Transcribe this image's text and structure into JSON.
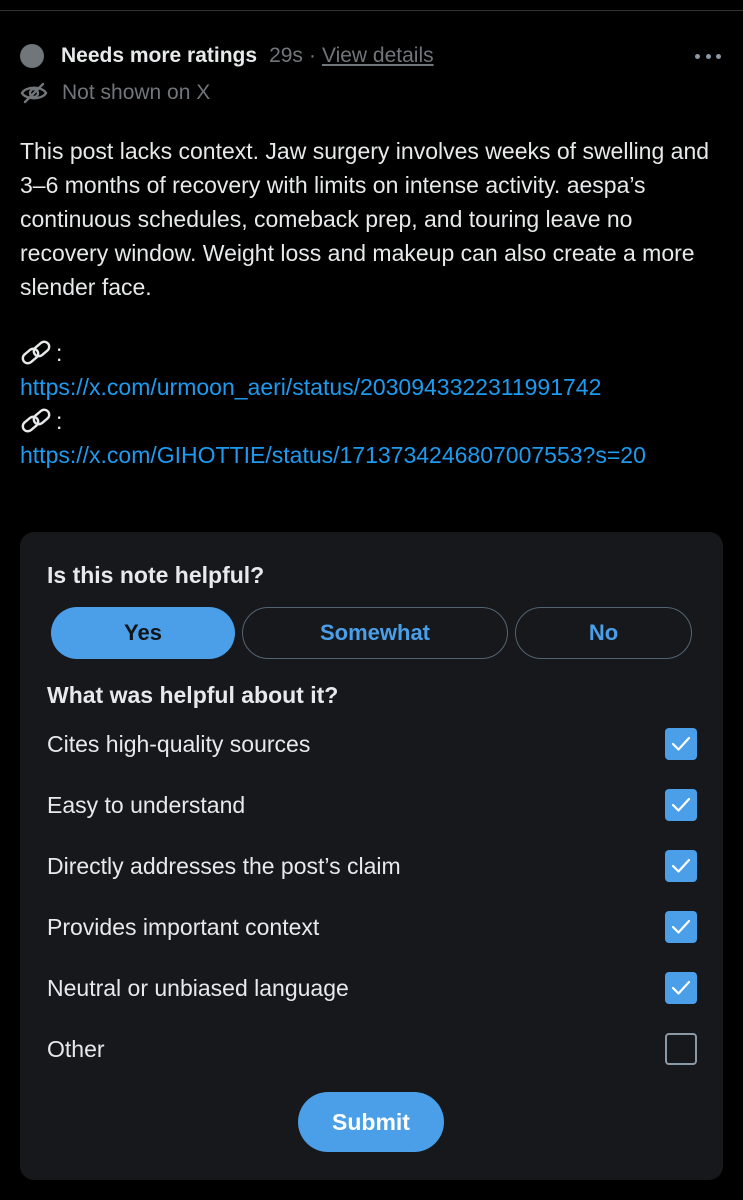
{
  "note": {
    "status_label": "Needs more ratings",
    "time": "29s",
    "separator": "·",
    "view_details": "View details",
    "visibility": "Not shown on X",
    "body": "This post lacks context. Jaw surgery involves weeks of swelling and 3–6 months of recovery with limits on intense activity. aespa’s continuous schedules, comeback prep, and touring leave no recovery window. Weight loss and makeup can also create a more slender face.",
    "links": [
      {
        "prefix": ":",
        "url": "https://x.com/urmoon_aeri/status/2030943322311991742"
      },
      {
        "prefix": ":",
        "url": "https://x.com/GIHOTTIE/status/1713734246807007553?s=20"
      }
    ]
  },
  "rating": {
    "question": "Is this note helpful?",
    "choices": [
      {
        "label": "Yes",
        "selected": true
      },
      {
        "label": "Somewhat",
        "selected": false
      },
      {
        "label": "No",
        "selected": false
      }
    ],
    "helpful_question": "What was helpful about it?",
    "options": [
      {
        "label": "Cites high-quality sources",
        "checked": true
      },
      {
        "label": "Easy to understand",
        "checked": true
      },
      {
        "label": "Directly addresses the post’s claim",
        "checked": true
      },
      {
        "label": "Provides important context",
        "checked": true
      },
      {
        "label": "Neutral or unbiased language",
        "checked": true
      },
      {
        "label": "Other",
        "checked": false
      }
    ],
    "submit_label": "Submit"
  },
  "colors": {
    "background": "#000000",
    "card": "#16181c",
    "accent": "#4a9fe8",
    "link": "#1d9bf0",
    "muted": "#71767b",
    "text": "#e7e9ea"
  },
  "icons": {
    "status": "gray-dot-icon",
    "visibility": "eye-slash-icon",
    "link": "link-chain-icon",
    "more": "more-dots-icon",
    "check": "checkmark-icon"
  }
}
